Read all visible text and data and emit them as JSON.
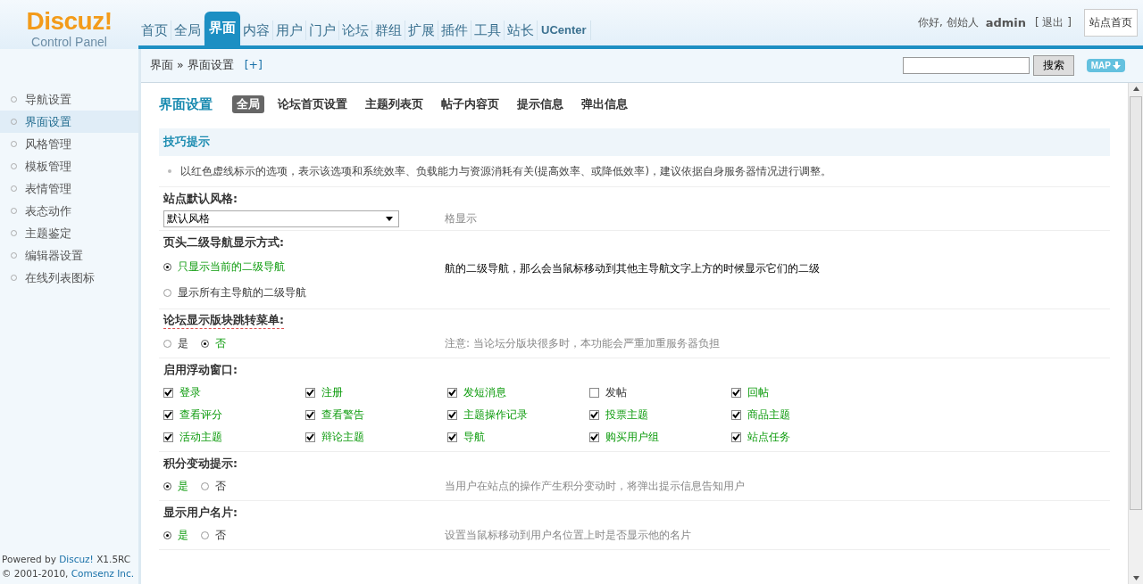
{
  "logo": {
    "name": "Discuz!",
    "subtitle": "Control Panel"
  },
  "nav": [
    {
      "label": "首页",
      "selected": false
    },
    {
      "label": "全局",
      "selected": false
    },
    {
      "label": "界面",
      "selected": true
    },
    {
      "label": "内容",
      "selected": false
    },
    {
      "label": "用户",
      "selected": false
    },
    {
      "label": "门户",
      "selected": false
    },
    {
      "label": "论坛",
      "selected": false
    },
    {
      "label": "群组",
      "selected": false
    },
    {
      "label": "扩展",
      "selected": false
    },
    {
      "label": "插件",
      "selected": false
    },
    {
      "label": "工具",
      "selected": false
    },
    {
      "label": "站长",
      "selected": false
    },
    {
      "label": "UCenter",
      "selected": false
    }
  ],
  "user": {
    "greeting": "你好, 创始人",
    "name": "admin",
    "logout": "[ 退出 ]",
    "home_button": "站点首页"
  },
  "breadcrumb": {
    "parent": "界面",
    "separator": "»",
    "current": "界面设置",
    "add": "[+]"
  },
  "search": {
    "button": "搜索"
  },
  "map_button": "MAP",
  "sidebar": {
    "items": [
      {
        "label": "导航设置",
        "selected": false
      },
      {
        "label": "界面设置",
        "selected": true
      },
      {
        "label": "风格管理",
        "selected": false
      },
      {
        "label": "模板管理",
        "selected": false
      },
      {
        "label": "表情管理",
        "selected": false
      },
      {
        "label": "表态动作",
        "selected": false
      },
      {
        "label": "主题鉴定",
        "selected": false
      },
      {
        "label": "编辑器设置",
        "selected": false
      },
      {
        "label": "在线列表图标",
        "selected": false
      }
    ],
    "footer": {
      "powered_prefix": "Powered by",
      "product": "Discuz!",
      "version": "X1.5RC",
      "copyright": "© 2001-2010,",
      "company": "Comsenz Inc."
    }
  },
  "page": {
    "title": "界面设置",
    "tabs": [
      {
        "label": "全局",
        "selected": true
      },
      {
        "label": "论坛首页设置",
        "selected": false
      },
      {
        "label": "主题列表页",
        "selected": false
      },
      {
        "label": "帖子内容页",
        "selected": false
      },
      {
        "label": "提示信息",
        "selected": false
      },
      {
        "label": "弹出信息",
        "selected": false
      }
    ]
  },
  "tips": {
    "title": "技巧提示",
    "items": [
      "以红色虚线标示的选项，表示该选项和系统效率、负载能力与资源消耗有关(提高效率、或降低效率)，建议依据自身服务器情况进行调整。"
    ]
  },
  "settings": [
    {
      "kind": "select",
      "label": "站点默认风格:",
      "performance_impact": false,
      "value": "默认风格",
      "hint": "格显示"
    },
    {
      "kind": "radiolist",
      "label": "页头二级导航显示方式:",
      "performance_impact": false,
      "options": [
        {
          "label": "只显示当前的二级导航",
          "selected": true
        },
        {
          "label": "显示所有主导航的二级导航",
          "selected": false
        }
      ],
      "hint": "航的二级导航，那么会当鼠标移动到其他主导航文字上方的时候显示它们的二级"
    },
    {
      "kind": "radio",
      "label": "论坛显示版块跳转菜单:",
      "performance_impact": true,
      "options": [
        {
          "label": "是",
          "selected": false
        },
        {
          "label": "否",
          "selected": true
        }
      ],
      "hint": "注意: 当论坛分版块很多时，本功能会严重加重服务器负担"
    },
    {
      "kind": "checkboxes",
      "label": "启用浮动窗口:",
      "performance_impact": false,
      "options": [
        {
          "label": "登录",
          "checked": true
        },
        {
          "label": "注册",
          "checked": true
        },
        {
          "label": "发短消息",
          "checked": true
        },
        {
          "label": "发帖",
          "checked": false
        },
        {
          "label": "回帖",
          "checked": true
        },
        {
          "label": "查看评分",
          "checked": true
        },
        {
          "label": "查看警告",
          "checked": true
        },
        {
          "label": "主题操作记录",
          "checked": true
        },
        {
          "label": "投票主题",
          "checked": true
        },
        {
          "label": "商品主题",
          "checked": true
        },
        {
          "label": "活动主题",
          "checked": true
        },
        {
          "label": "辩论主题",
          "checked": true
        },
        {
          "label": "导航",
          "checked": true
        },
        {
          "label": "购买用户组",
          "checked": true
        },
        {
          "label": "站点任务",
          "checked": true
        }
      ]
    },
    {
      "kind": "radio",
      "label": "积分变动提示:",
      "performance_impact": false,
      "options": [
        {
          "label": "是",
          "selected": true
        },
        {
          "label": "否",
          "selected": false
        }
      ],
      "hint": "当用户在站点的操作产生积分变动时，将弹出提示信息告知用户"
    },
    {
      "kind": "radio",
      "label": "显示用户名片:",
      "performance_impact": false,
      "options": [
        {
          "label": "是",
          "selected": true
        },
        {
          "label": "否",
          "selected": false
        }
      ],
      "hint": "设置当鼠标移动到用户名位置上时是否显示他的名片"
    }
  ]
}
